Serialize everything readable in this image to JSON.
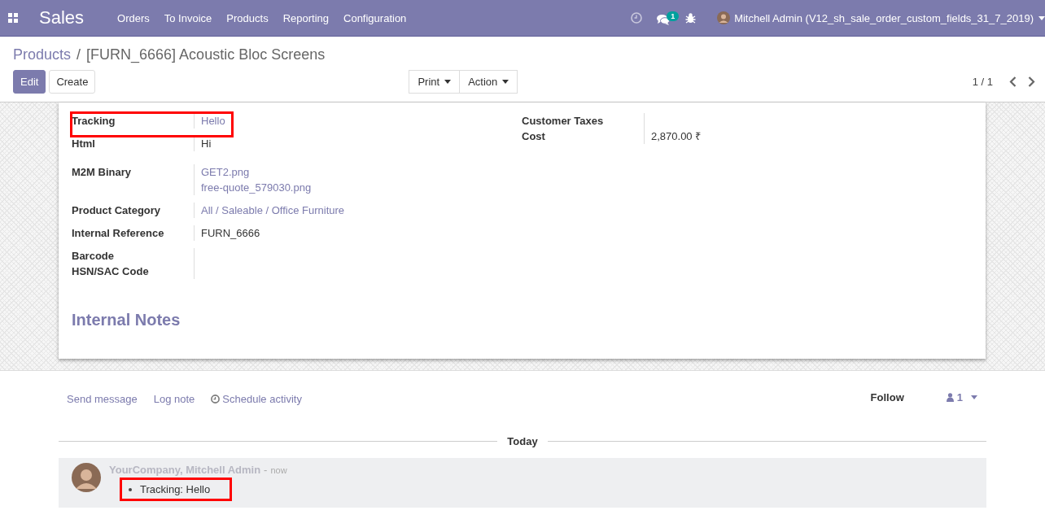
{
  "topbar": {
    "app": "Sales",
    "menu": [
      "Orders",
      "To Invoice",
      "Products",
      "Reporting",
      "Configuration"
    ],
    "message_count": "1",
    "user": "Mitchell Admin (V12_sh_sale_order_custom_fields_31_7_2019)"
  },
  "breadcrumb": {
    "parent": "Products",
    "separator": "/",
    "current": "[FURN_6666] Acoustic Bloc Screens"
  },
  "buttons": [
    "Edit",
    "Create"
  ],
  "dropdowns": [
    "Print",
    "Action"
  ],
  "pager": "1 / 1",
  "left_fields": [
    {
      "label": "Tracking",
      "kind": "link",
      "values": [
        "Hello"
      ],
      "highlighted": true
    },
    {
      "label": "Html",
      "kind": "html",
      "values": [
        "Hi"
      ]
    },
    {
      "label": "M2M Binary",
      "kind": "link",
      "values": [
        "GET2.png",
        "free-quote_579030.png"
      ]
    },
    {
      "label": "Product Category",
      "kind": "link",
      "values": [
        "All / Saleable / Office Furniture"
      ]
    },
    {
      "label": "Internal Reference",
      "kind": "text",
      "values": [
        "FURN_6666"
      ]
    },
    {
      "label": "Barcode"
    },
    {
      "label": "HSN/SAC Code"
    }
  ],
  "right_fields": [
    {
      "label": "Customer Taxes"
    },
    {
      "label": "Cost",
      "kind": "text",
      "values": [
        "2,870.00 ₹"
      ]
    }
  ],
  "section_title": "Internal Notes",
  "chatter": {
    "actions": [
      "Send message",
      "Log note",
      "Schedule activity"
    ],
    "follow": "Follow",
    "followers": "1",
    "divider": "Today",
    "messages": [
      {
        "author": "YourCompany, Mitchell Admin",
        "separator": "-",
        "time": "now",
        "lines": [
          "Tracking: Hello"
        ],
        "highlighted": true
      }
    ]
  }
}
